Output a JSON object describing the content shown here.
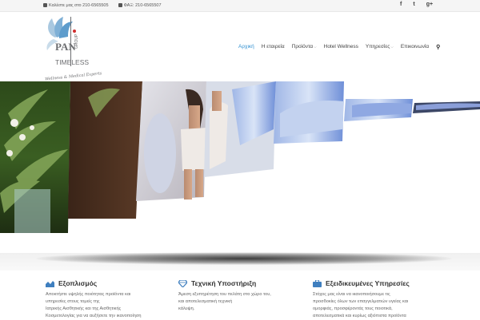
{
  "topbar": {
    "phone": "Καλέστε μας στο 210-6565505",
    "fax": "ΦΑΞ: 210-6565507",
    "social": [
      "f",
      "t",
      "g+"
    ]
  },
  "logo": {
    "text_pan": "PAN",
    "text_group": "GROUP",
    "text_timeless": "TIMELESS",
    "tagline": "Wellness & Medical Experts!"
  },
  "nav": {
    "items": [
      {
        "label": "Αρχική",
        "active": true,
        "dropdown": false
      },
      {
        "label": "Η εταιρεία",
        "active": false,
        "dropdown": false
      },
      {
        "label": "Προϊόντα",
        "active": false,
        "dropdown": true
      },
      {
        "label": "Hotel Wellness",
        "active": false,
        "dropdown": false
      },
      {
        "label": "Υπηρεσίες",
        "active": false,
        "dropdown": true
      },
      {
        "label": "Επικοινωνία",
        "active": false,
        "dropdown": false
      }
    ],
    "search_icon": "search-icon",
    "active_color": "#2f8fd0"
  },
  "features": [
    {
      "icon": "chart-icon",
      "title": "Εξοπλισμός",
      "lines": [
        "Αποκτήστε υψηλής ποιότητας προϊόντα και",
        "υπηρεσίες στους τομείς της",
        "Ιατρικής Αισθητικής και της Αισθητικής",
        "Κοσμετολογίας για να αυξήσετε την ικανοποίηση"
      ]
    },
    {
      "icon": "diamond-icon",
      "title": "Τεχνική Υποστήριξη",
      "lines": [
        "Άμεση εξυπηρέτηση του πελάτη στο χώρο του,",
        "και αποτελεσματική τεχνική",
        "κάλυψη."
      ]
    },
    {
      "icon": "briefcase-icon",
      "title": "Εξειδικευμένες Υπηρεσίες",
      "lines": [
        "Στόχος μας είναι να ικανοποιήσουμε τις",
        "προσδοκίες όλων των επαγγελματιών υγείας και",
        "ομορφιάς, προσφέροντάς τους ποιοτικά,",
        "αποτελεσματικά και κυρίως αξιόπιστα προϊόντα"
      ]
    }
  ],
  "colors": {
    "accent": "#2f8fd0",
    "icon_blue": "#3f7fbf",
    "logo_gray": "#6d6e71",
    "logo_red": "#d12e2e"
  }
}
